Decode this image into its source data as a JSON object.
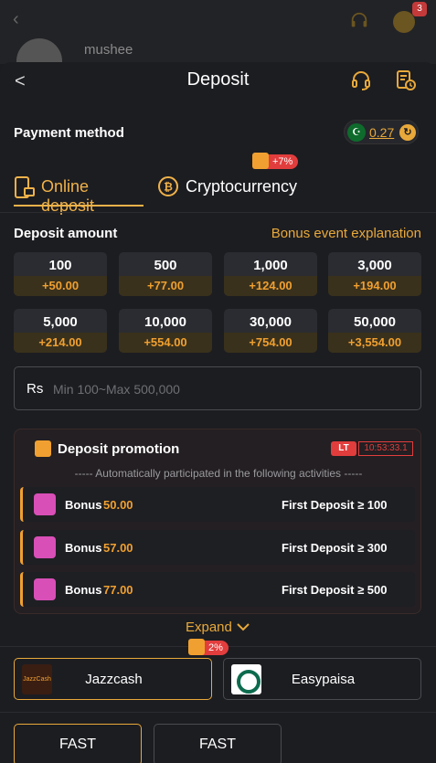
{
  "background": {
    "username": "mushee",
    "notification_count": "3"
  },
  "header": {
    "title": "Deposit"
  },
  "payment_method": {
    "label": "Payment method",
    "balance": "0.27"
  },
  "tabs": [
    {
      "label": "Online deposit",
      "active": true
    },
    {
      "label": "Cryptocurrency",
      "active": false,
      "tag": "+7%"
    }
  ],
  "deposit_amount": {
    "label": "Deposit amount",
    "bonus_link": "Bonus event explanation",
    "options": [
      {
        "amount": "100",
        "bonus": "+50.00"
      },
      {
        "amount": "500",
        "bonus": "+77.00"
      },
      {
        "amount": "1,000",
        "bonus": "+124.00"
      },
      {
        "amount": "3,000",
        "bonus": "+194.00"
      },
      {
        "amount": "5,000",
        "bonus": "+214.00"
      },
      {
        "amount": "10,000",
        "bonus": "+554.00"
      },
      {
        "amount": "30,000",
        "bonus": "+754.00"
      },
      {
        "amount": "50,000",
        "bonus": "+3,554.00"
      }
    ]
  },
  "input": {
    "currency": "Rs",
    "placeholder": "Min 100~Max 500,000"
  },
  "promotion": {
    "title": "Deposit promotion",
    "badge": "LT",
    "timer": "10:53:33.1",
    "subtitle": "----- Automatically participated in the following activities -----",
    "items": [
      {
        "word": "Bonus",
        "value": "50.00",
        "condition": "First Deposit ≥ 100"
      },
      {
        "word": "Bonus",
        "value": "57.00",
        "condition": "First Deposit ≥ 300"
      },
      {
        "word": "Bonus",
        "value": "77.00",
        "condition": "First Deposit ≥ 500"
      }
    ]
  },
  "expand": {
    "label": "Expand"
  },
  "methods": [
    {
      "label": "Jazzcash",
      "logo_text": "JazzCash",
      "tag": "2%",
      "selected": true
    },
    {
      "label": "Easypaisa",
      "selected": false
    }
  ],
  "channels": [
    {
      "label": "FAST",
      "selected": true
    },
    {
      "label": "FAST",
      "selected": false
    }
  ],
  "colors": {
    "accent": "#e9a93a",
    "bonus": "#f0a030",
    "alert": "#e23d3d",
    "background": "#1c1d21"
  }
}
